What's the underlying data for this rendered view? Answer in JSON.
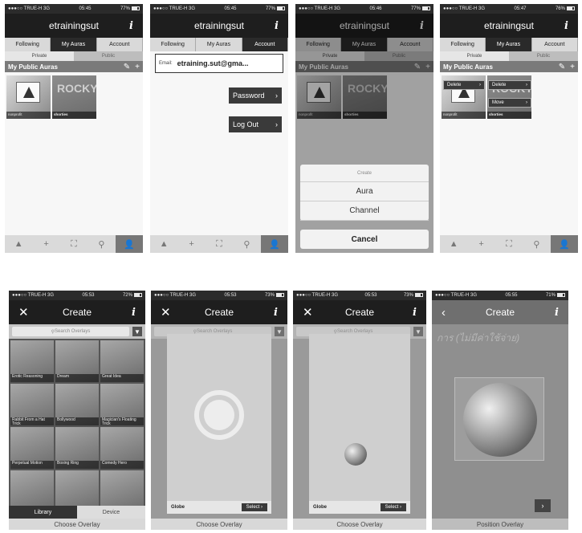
{
  "status": {
    "carrier": "●●●○○ TRUE-H  3G",
    "battery": "77%"
  },
  "s1": {
    "time": "05:45",
    "title": "etrainingsut",
    "info": "i",
    "segments": [
      "Following",
      "My Auras",
      "Account"
    ],
    "subsegments": [
      "Private",
      "Public"
    ],
    "section": "My Public Auras",
    "edit_icon": "pencil-icon",
    "add_icon": "plus-icon",
    "thumbs": [
      {
        "label": "nonprofit"
      },
      {
        "label": "shorties",
        "art": "ROCKY"
      }
    ]
  },
  "s2": {
    "time": "05:45",
    "battery": "77%",
    "title": "etrainingsut",
    "email_label": "Email:",
    "email": "etraining.sut@gma...",
    "password": "Password",
    "logout": "Log Out"
  },
  "s3": {
    "time": "05:46",
    "battery": "77%",
    "title": "etrainingsut",
    "sheet_title": "Create",
    "option1": "Aura",
    "option2": "Channel",
    "cancel": "Cancel"
  },
  "s4": {
    "time": "05:47",
    "battery": "76%",
    "title": "etrainingsut",
    "delete1": "Delete",
    "delete2": "Delete",
    "move": "Move"
  },
  "tabs": [
    "▲",
    "+",
    "⛶",
    "⚲",
    "👤"
  ],
  "s5": {
    "time": "05:53",
    "battery": "72%",
    "title": "Create",
    "close": "✕",
    "search_placeholder": "Search Overlays",
    "cells": [
      "Erotic Reasoning",
      "Dream",
      "Great Idea",
      "Rabbit From a Hat Trick",
      "Bollywood",
      "Magician's Floating Trick",
      "Perpetual Motion",
      "Boxing Ring",
      "Comedy Hero",
      "",
      "",
      ""
    ],
    "lib_tab": "Library",
    "dev_tab": "Device",
    "footer": "Choose Overlay"
  },
  "s6": {
    "time": "05:53",
    "battery": "73%",
    "title": "Create",
    "item": "Globe",
    "select": "Select",
    "footer": "Choose Overlay"
  },
  "s7": {
    "time": "05:53",
    "battery": "73%",
    "title": "Create",
    "item": "Globe",
    "select": "Select",
    "footer": "Choose Overlay"
  },
  "s8": {
    "time": "05:55",
    "battery": "71%",
    "title": "Create",
    "bg_text": "การ (ไม่มีค่าใช้จ่าย)",
    "footer": "Position Overlay"
  }
}
